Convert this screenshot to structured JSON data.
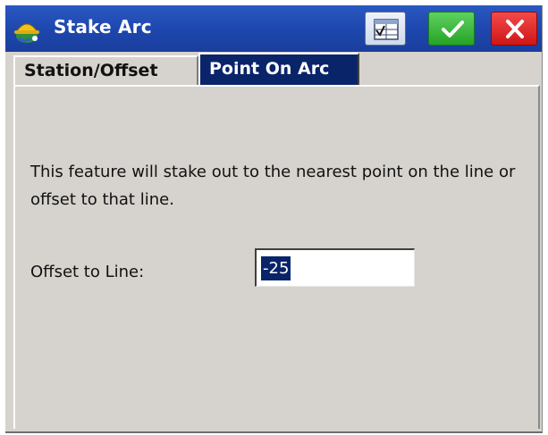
{
  "window": {
    "title": "Stake Arc",
    "app_icon": "surveyor-helmet-icon",
    "buttons": {
      "table": "table-check-icon",
      "ok": "checkmark-icon",
      "cancel": "close-icon"
    }
  },
  "tabs": [
    {
      "label": "Station/Offset",
      "active": false
    },
    {
      "label": "Point On Arc",
      "active": true
    }
  ],
  "content": {
    "description": "This feature will stake out to the nearest point on the line or offset to that line.",
    "offset_label": "Offset to Line:",
    "offset_value": "-25"
  },
  "colors": {
    "titlebar": "#1d46ad",
    "active_tab": "#0a246a",
    "ok_button": "#26a326",
    "cancel_button": "#cf1616",
    "background": "#d6d3ce"
  }
}
